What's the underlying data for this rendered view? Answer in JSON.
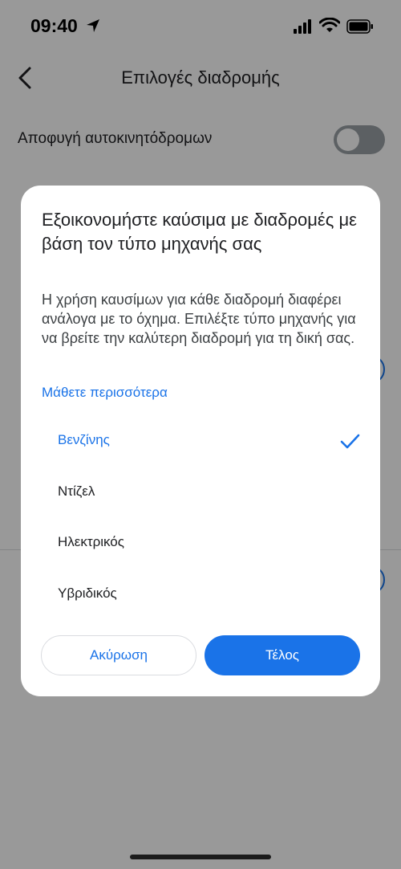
{
  "status_bar": {
    "time": "09:40"
  },
  "header": {
    "title": "Επιλογές διαδρομής"
  },
  "settings": {
    "avoid_highways_label": "Αποφυγή αυτοκινητόδρομων"
  },
  "dialog": {
    "title": "Εξοικονομήστε καύσιμα με διαδρομές με βάση τον τύπο μηχανής σας",
    "body": "Η χρήση καυσίμων για κάθε διαδρομή διαφέρει ανάλογα με το όχημα. Επιλέξτε τύπο μηχανής για να βρείτε την καλύτερη διαδρομή για τη δική σας.",
    "learn_more": "Μάθετε περισσότερα",
    "options": [
      {
        "label": "Βενζίνης",
        "selected": true
      },
      {
        "label": "Ντίζελ",
        "selected": false
      },
      {
        "label": "Ηλεκτρικός",
        "selected": false
      },
      {
        "label": "Υβριδικός",
        "selected": false
      }
    ],
    "cancel_label": "Ακύρωση",
    "done_label": "Τέλος"
  },
  "colors": {
    "accent": "#1a73e8",
    "scrim": "rgba(0,0,0,0.4)",
    "text_primary": "#202124"
  }
}
